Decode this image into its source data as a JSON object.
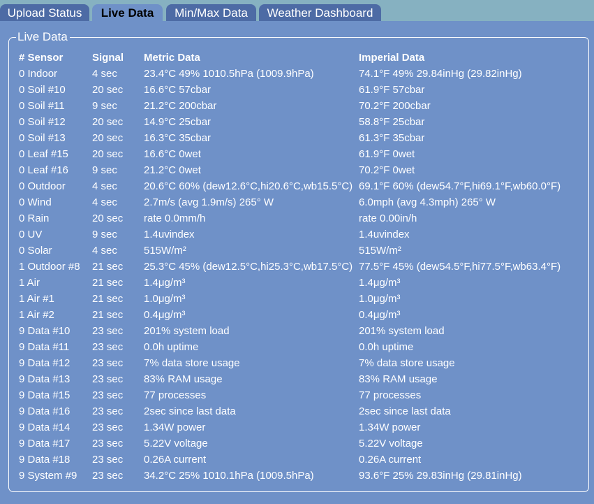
{
  "tabs": [
    {
      "label": "Upload Status",
      "active": false
    },
    {
      "label": "Live Data",
      "active": true
    },
    {
      "label": "Min/Max Data",
      "active": false
    },
    {
      "label": "Weather Dashboard",
      "active": false
    }
  ],
  "panel": {
    "legend": "Live Data"
  },
  "table": {
    "headers": [
      "# Sensor",
      "Signal",
      "Metric Data",
      "Imperial Data"
    ],
    "rows": [
      [
        "0 Indoor",
        "4 sec",
        "23.4°C 49% 1010.5hPa (1009.9hPa)",
        "74.1°F 49% 29.84inHg (29.82inHg)"
      ],
      [
        "0 Soil #10",
        "20 sec",
        "16.6°C 57cbar",
        "61.9°F 57cbar"
      ],
      [
        "0 Soil #11",
        "9 sec",
        "21.2°C 200cbar",
        "70.2°F 200cbar"
      ],
      [
        "0 Soil #12",
        "20 sec",
        "14.9°C 25cbar",
        "58.8°F 25cbar"
      ],
      [
        "0 Soil #13",
        "20 sec",
        "16.3°C 35cbar",
        "61.3°F 35cbar"
      ],
      [
        "0 Leaf #15",
        "20 sec",
        "16.6°C 0wet",
        "61.9°F 0wet"
      ],
      [
        "0 Leaf #16",
        "9 sec",
        "21.2°C 0wet",
        "70.2°F 0wet"
      ],
      [
        "0 Outdoor",
        "4 sec",
        "20.6°C 60% (dew12.6°C,hi20.6°C,wb15.5°C)",
        "69.1°F 60% (dew54.7°F,hi69.1°F,wb60.0°F)"
      ],
      [
        "0 Wind",
        "4 sec",
        "2.7m/s (avg 1.9m/s) 265° W",
        "6.0mph (avg 4.3mph) 265° W"
      ],
      [
        "0 Rain",
        "20 sec",
        "rate 0.0mm/h",
        "rate 0.00in/h"
      ],
      [
        "0 UV",
        "9 sec",
        "1.4uvindex",
        "1.4uvindex"
      ],
      [
        "0 Solar",
        "4 sec",
        "515W/m²",
        "515W/m²"
      ],
      [
        "1 Outdoor #8",
        "21 sec",
        "25.3°C 45% (dew12.5°C,hi25.3°C,wb17.5°C)",
        "77.5°F 45% (dew54.5°F,hi77.5°F,wb63.4°F)"
      ],
      [
        "1 Air",
        "21 sec",
        "1.4μg/m³",
        "1.4μg/m³"
      ],
      [
        "1 Air #1",
        "21 sec",
        "1.0μg/m³",
        "1.0μg/m³"
      ],
      [
        "1 Air #2",
        "21 sec",
        "0.4μg/m³",
        "0.4μg/m³"
      ],
      [
        "9 Data #10",
        "23 sec",
        "201% system load",
        "201% system load"
      ],
      [
        "9 Data #11",
        "23 sec",
        "0.0h uptime",
        "0.0h uptime"
      ],
      [
        "9 Data #12",
        "23 sec",
        "7% data store usage",
        "7% data store usage"
      ],
      [
        "9 Data #13",
        "23 sec",
        "83% RAM usage",
        "83% RAM usage"
      ],
      [
        "9 Data #15",
        "23 sec",
        "77 processes",
        "77 processes"
      ],
      [
        "9 Data #16",
        "23 sec",
        "2sec since last data",
        "2sec since last data"
      ],
      [
        "9 Data #14",
        "23 sec",
        "1.34W power",
        "1.34W power"
      ],
      [
        "9 Data #17",
        "23 sec",
        "5.22V voltage",
        "5.22V voltage"
      ],
      [
        "9 Data #18",
        "23 sec",
        "0.26A current",
        "0.26A current"
      ],
      [
        "9 System #9",
        "23 sec",
        "34.2°C 25% 1010.1hPa (1009.5hPa)",
        "93.6°F 25% 29.83inHg (29.81inHg)"
      ]
    ]
  },
  "colors": {
    "background": "#6f91c8",
    "tab_bar": "#86b1c1",
    "tab_inactive": "#4d6ba5",
    "text": "#ffffff"
  }
}
